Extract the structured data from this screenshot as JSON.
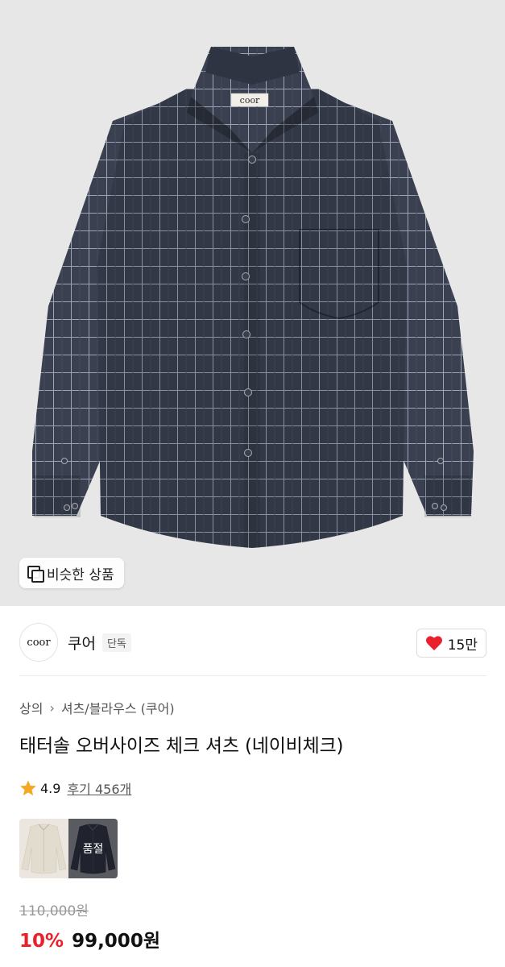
{
  "hero": {
    "similar_label": "비슷한 상품",
    "logo_tag": "coor"
  },
  "brand": {
    "logo_text": "coor",
    "name": "쿠어",
    "badge": "단독",
    "likes": "15만"
  },
  "breadcrumb": {
    "category": "상의",
    "subcategory": "셔츠/블라우스 (쿠어)"
  },
  "product": {
    "title": "태터솔 오버사이즈 체크 셔츠 (네이비체크)",
    "rating": "4.9",
    "review_label": "후기 456개"
  },
  "colors": {
    "options": [
      {
        "name": "ivory",
        "soldout": false
      },
      {
        "name": "navy",
        "soldout": true
      }
    ],
    "soldout_label": "품절"
  },
  "pricing": {
    "original": "110,000원",
    "discount": "10%",
    "price": "99,000원"
  },
  "theme": {
    "accent": "#e8212c",
    "star": "#f5a623"
  }
}
